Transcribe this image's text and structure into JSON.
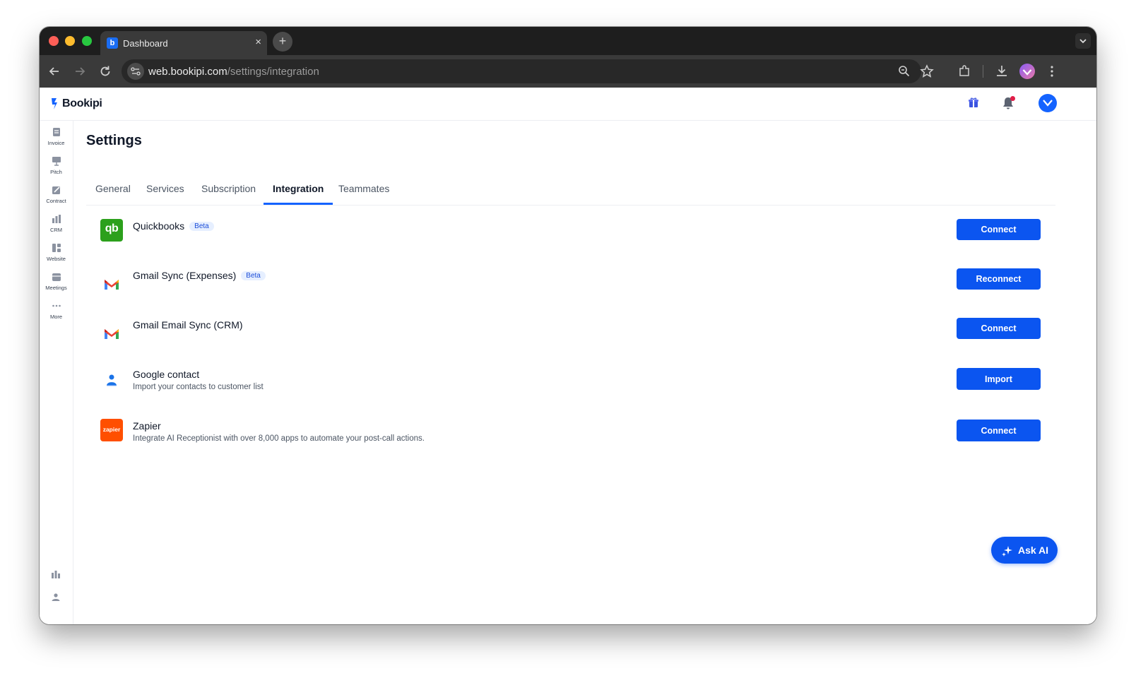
{
  "browser": {
    "tab_title": "Dashboard",
    "tab_close": "×",
    "new_tab": "+",
    "url_host": "web.bookipi.com",
    "url_path": "/settings/integration"
  },
  "app": {
    "brand": "Bookipi",
    "colors": {
      "accent": "#0b55f0",
      "badge_bg": "#e6efff",
      "badge_text": "#1d4ed8"
    }
  },
  "sidebar": {
    "items": [
      {
        "label": "Invoice",
        "icon": "invoice-icon"
      },
      {
        "label": "Pitch",
        "icon": "pitch-icon"
      },
      {
        "label": "Contract",
        "icon": "contract-icon"
      },
      {
        "label": "CRM",
        "icon": "crm-icon"
      },
      {
        "label": "Website",
        "icon": "website-icon"
      },
      {
        "label": "Meetings",
        "icon": "meetings-icon"
      },
      {
        "label": "More",
        "icon": "more-icon"
      }
    ],
    "bottom_icons": [
      "analytics-icon",
      "profile-icon"
    ]
  },
  "page": {
    "title": "Settings",
    "tabs": [
      "General",
      "Services",
      "Subscription",
      "Integration",
      "Teammates"
    ],
    "active_tab": "Integration"
  },
  "integrations": [
    {
      "name": "Quickbooks",
      "badge": "Beta",
      "desc": "",
      "button": "Connect",
      "icon": "quickbooks-icon"
    },
    {
      "name": "Gmail Sync (Expenses)",
      "badge": "Beta",
      "desc": "",
      "button": "Reconnect",
      "icon": "gmail-icon"
    },
    {
      "name": "Gmail Email Sync (CRM)",
      "badge": "",
      "desc": "",
      "button": "Connect",
      "icon": "gmail-icon"
    },
    {
      "name": "Google contact",
      "badge": "",
      "desc": "Import your contacts to customer list",
      "button": "Import",
      "icon": "google-contacts-icon"
    },
    {
      "name": "Zapier",
      "badge": "",
      "desc": "Integrate AI Receptionist with over 8,000 apps to automate your post-call actions.",
      "button": "Connect",
      "icon": "zapier-icon"
    }
  ],
  "icons": {
    "zapier_text": "zapier",
    "quickbooks_text": "qb"
  },
  "ask_ai": "Ask AI"
}
